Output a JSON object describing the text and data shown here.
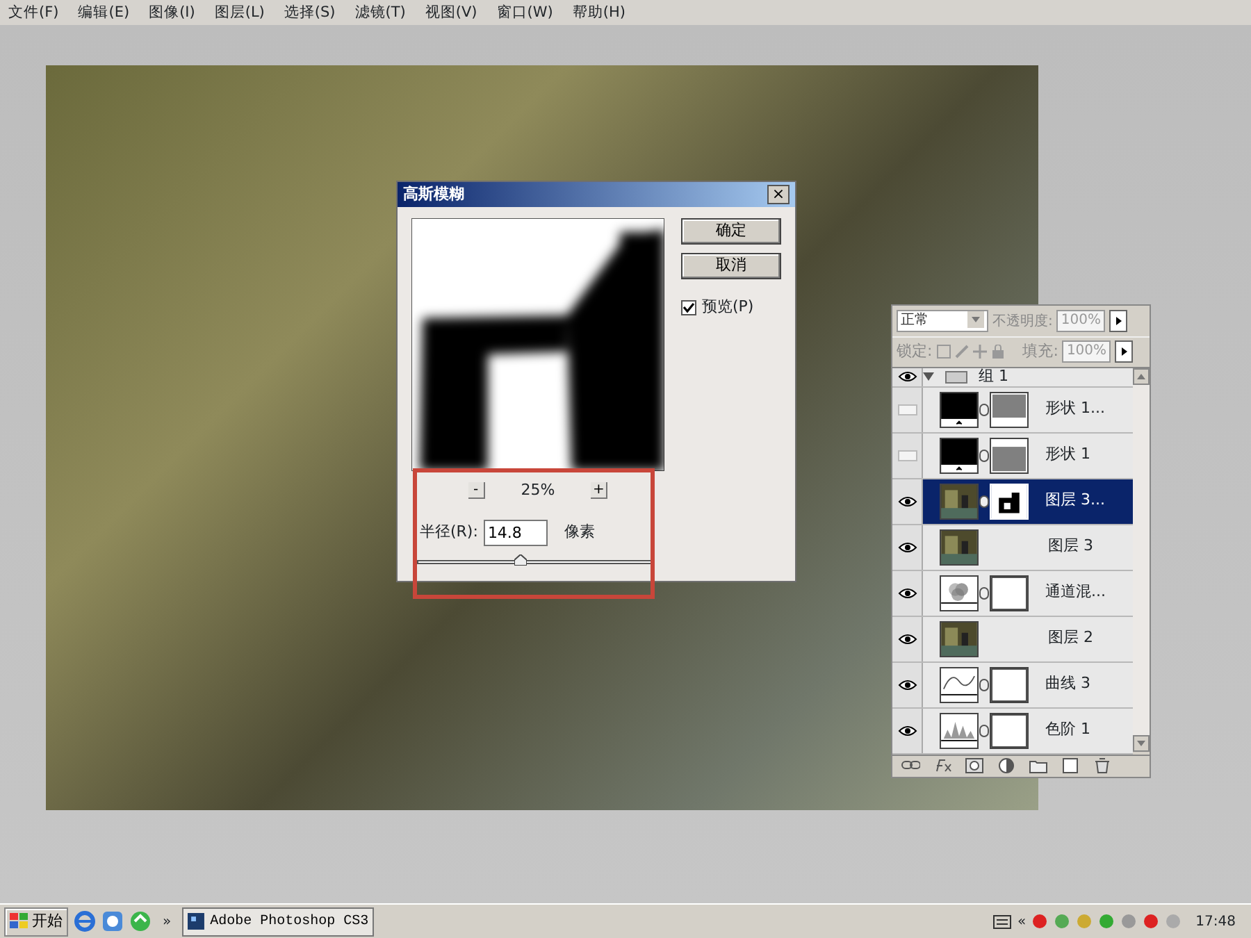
{
  "menu": [
    "文件(F)",
    "编辑(E)",
    "图像(I)",
    "图层(L)",
    "选择(S)",
    "滤镜(T)",
    "视图(V)",
    "窗口(W)",
    "帮助(H)"
  ],
  "dialog": {
    "title": "高斯模糊",
    "close": "×",
    "zoom_out": "-",
    "zoom": "25%",
    "zoom_in": "+",
    "buttons": [
      "确定",
      "取消"
    ],
    "preview": {
      "label": "预览(P)",
      "checked": true
    },
    "radius_label": "半径(R):",
    "radius": "14.8",
    "unit": "像素",
    "slider": {
      "level": 0.43
    }
  },
  "layers_panel": {
    "blend_mode": "正常",
    "opacity_label": "不透明度:",
    "opacity": "100%",
    "lock_label": "锁定:",
    "fill_label": "填充:",
    "fill": "100%",
    "group": {
      "name": "组 1",
      "visible": true
    },
    "layers": [
      {
        "name": "形状 1...",
        "visible": false,
        "selected": false,
        "thumbnail": {
          "kind": "shape"
        },
        "mask": {
          "kind": "greytop"
        }
      },
      {
        "name": "形状 1",
        "visible": false,
        "selected": false,
        "thumbnail": {
          "kind": "shape"
        },
        "mask": {
          "kind": "greybottom"
        }
      },
      {
        "name": "图层 3...",
        "visible": true,
        "selected": true,
        "thumbnail": {
          "kind": "photo"
        },
        "mask": {
          "kind": "figure"
        }
      },
      {
        "name": "图层 3",
        "visible": true,
        "selected": false,
        "thumbnail": {
          "kind": "photo"
        }
      },
      {
        "name": "通道混...",
        "visible": true,
        "selected": false,
        "thumbnail": {
          "kind": "mixer"
        },
        "mask": {
          "kind": "white"
        }
      },
      {
        "name": "图层 2",
        "visible": true,
        "selected": false,
        "thumbnail": {
          "kind": "photo"
        }
      },
      {
        "name": "曲线 3",
        "visible": true,
        "selected": false,
        "thumbnail": {
          "kind": "curves"
        },
        "mask": {
          "kind": "white"
        }
      },
      {
        "name": "色阶 1",
        "visible": true,
        "selected": false,
        "thumbnail": {
          "kind": "levels"
        },
        "mask": {
          "kind": "white"
        }
      }
    ]
  },
  "taskbar": {
    "start": "开始",
    "more": "»",
    "task": "Adobe Photoshop CS3",
    "tray_more": "«",
    "clock": "17:48"
  }
}
